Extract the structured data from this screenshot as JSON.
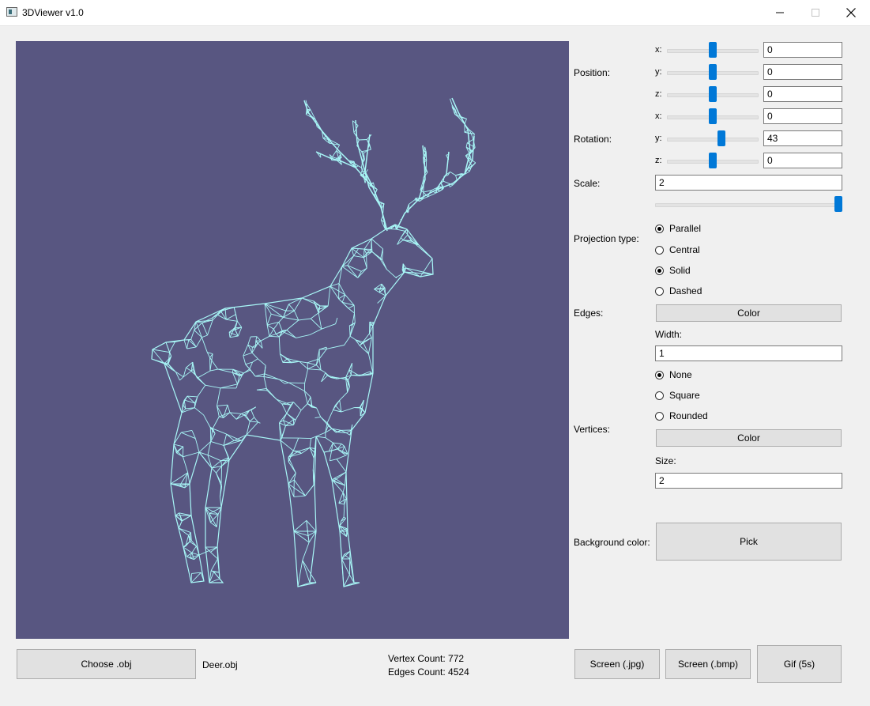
{
  "window": {
    "title": "3DViewer v1.0",
    "min_icon": "minimize-icon",
    "max_icon": "maximize-icon",
    "close_icon": "close-icon"
  },
  "viewport": {
    "background_color": "#585681",
    "mesh_color": "#a8f7f7",
    "mesh_icon": "deer-wireframe"
  },
  "position": {
    "label": "Position:",
    "x": {
      "label": "x:",
      "value": "0",
      "slider_fraction": 0.5
    },
    "y": {
      "label": "y:",
      "value": "0",
      "slider_fraction": 0.5
    },
    "z": {
      "label": "z:",
      "value": "0",
      "slider_fraction": 0.5
    }
  },
  "rotation": {
    "label": "Rotation:",
    "x": {
      "label": "x:",
      "value": "0",
      "slider_fraction": 0.5
    },
    "y": {
      "label": "y:",
      "value": "43",
      "slider_fraction": 0.6
    },
    "z": {
      "label": "z:",
      "value": "0",
      "slider_fraction": 0.5
    }
  },
  "scale": {
    "label": "Scale:",
    "value": "2",
    "slider_fraction": 1.0
  },
  "projection": {
    "label": "Projection type:",
    "options": [
      "Parallel",
      "Central"
    ],
    "selected": "Parallel"
  },
  "edges": {
    "label": "Edges:",
    "types": [
      "Solid",
      "Dashed"
    ],
    "selected": "Solid",
    "color_button": "Color",
    "width_label": "Width:",
    "width_value": "1"
  },
  "vertices": {
    "label": "Vertices:",
    "types": [
      "None",
      "Square",
      "Rounded"
    ],
    "selected": "None",
    "color_button": "Color",
    "size_label": "Size:",
    "size_value": "2"
  },
  "background": {
    "label": "Background color:",
    "button": "Pick"
  },
  "footer": {
    "choose_button": "Choose .obj",
    "file_name": "Deer.obj",
    "vertex_count": "Vertex Count: 772",
    "edges_count": "Edges Count: 4524",
    "screen_jpg": "Screen (.jpg)",
    "screen_bmp": "Screen (.bmp)",
    "gif": "Gif (5s)"
  }
}
